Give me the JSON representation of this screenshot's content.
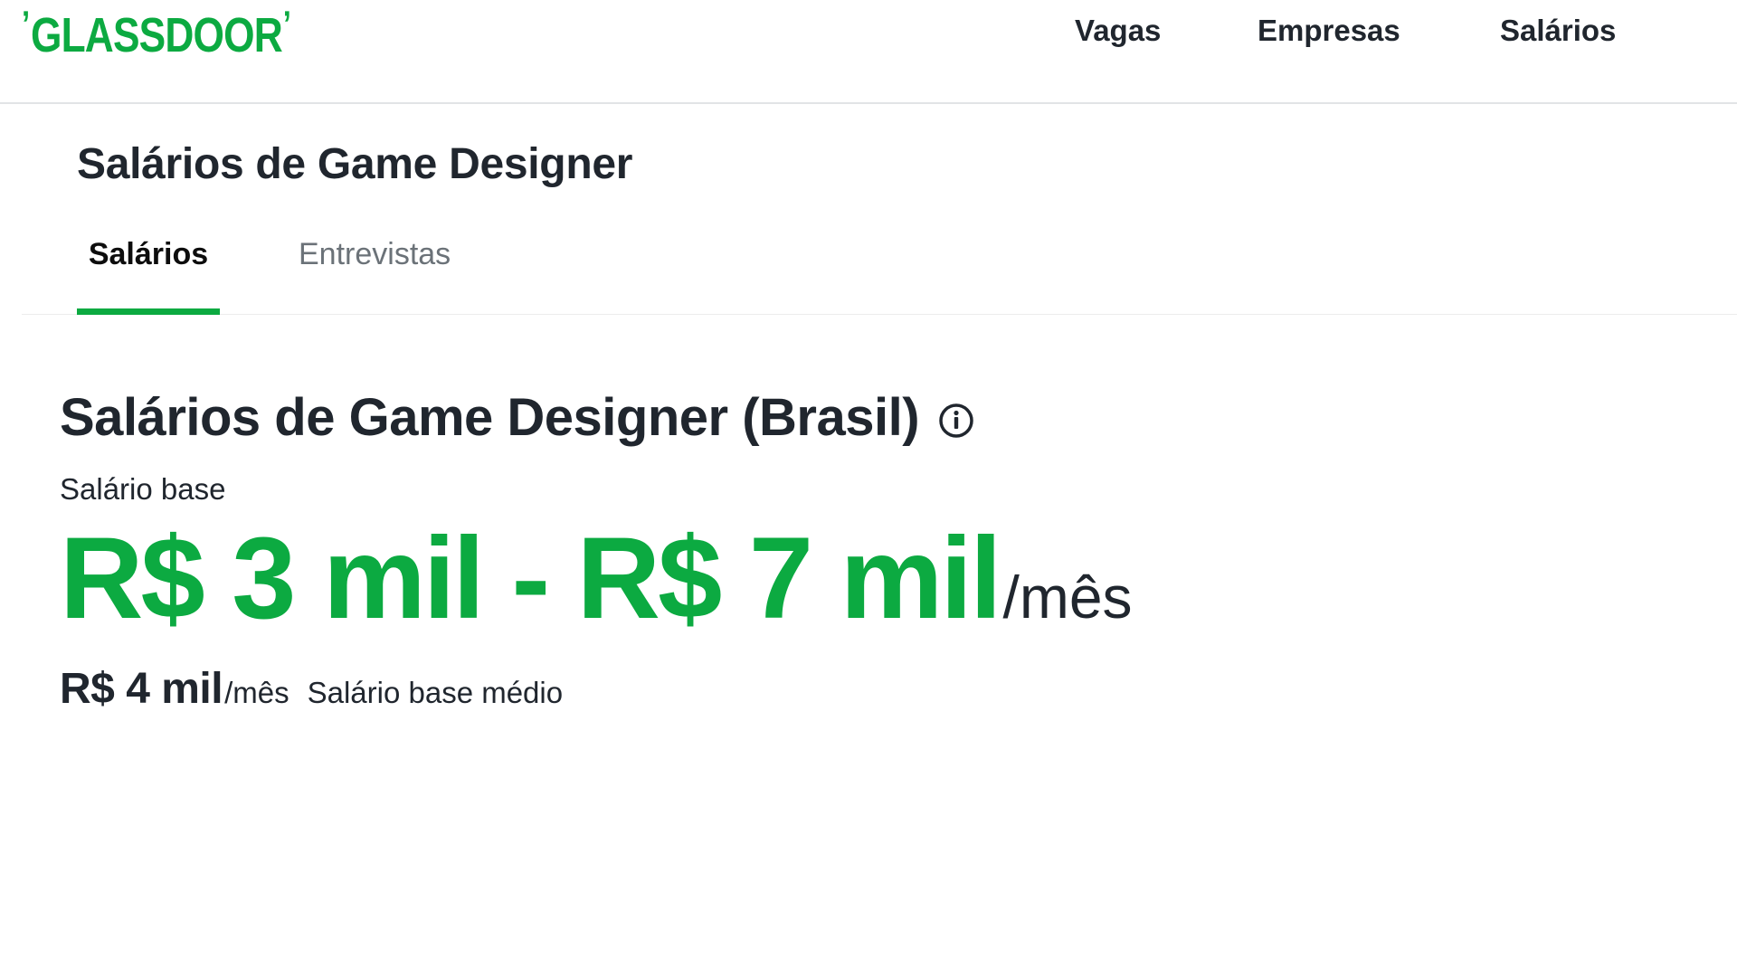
{
  "header": {
    "logo_text": "GLASSDOOR",
    "nav": {
      "vagas": "Vagas",
      "empresas": "Empresas",
      "salarios": "Salários"
    }
  },
  "page": {
    "heading": "Salários de Game Designer",
    "tabs": [
      {
        "label": "Salários",
        "active": true
      },
      {
        "label": "Entrevistas",
        "active": false
      }
    ]
  },
  "salary": {
    "title": "Salários de Game Designer (Brasil)",
    "info_icon": "info-icon",
    "base_label": "Salário base",
    "range_value": "R$ 3 mil - R$ 7 mil",
    "range_unit": "/mês",
    "median_value": "R$ 4 mil",
    "median_unit": "/mês",
    "median_label": "Salário base médio"
  },
  "colors": {
    "brand_green": "#0caa41",
    "text_dark": "#20262e",
    "tab_inactive": "#6b7278",
    "divider": "#e2e4e6"
  }
}
